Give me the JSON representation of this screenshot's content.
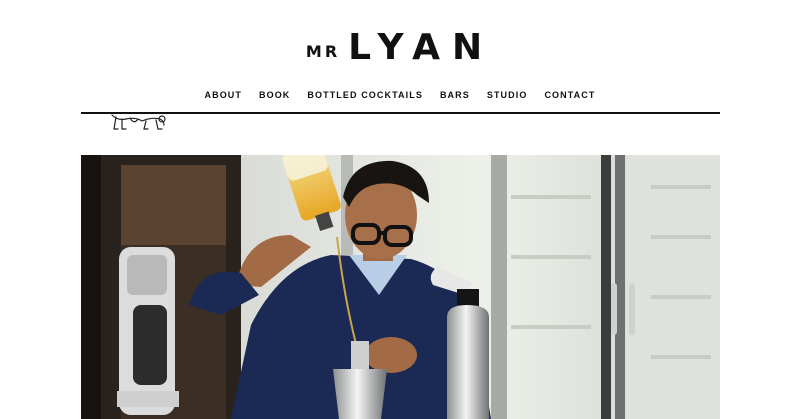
{
  "header": {
    "logo_prefix": "MR",
    "logo_main": "LYAN"
  },
  "nav": {
    "items": [
      {
        "label": "ABOUT"
      },
      {
        "label": "BOOK"
      },
      {
        "label": "BOTTLED COCKTAILS"
      },
      {
        "label": "BARS"
      },
      {
        "label": "STUDIO"
      },
      {
        "label": "CONTACT"
      }
    ]
  },
  "colors": {
    "background": "#ffffff",
    "text": "#111111",
    "rule": "#111111"
  },
  "icons": {
    "mascot": "lion-mascot-illustration"
  },
  "hero": {
    "image": "bartender-pouring-cocktail-photo"
  }
}
